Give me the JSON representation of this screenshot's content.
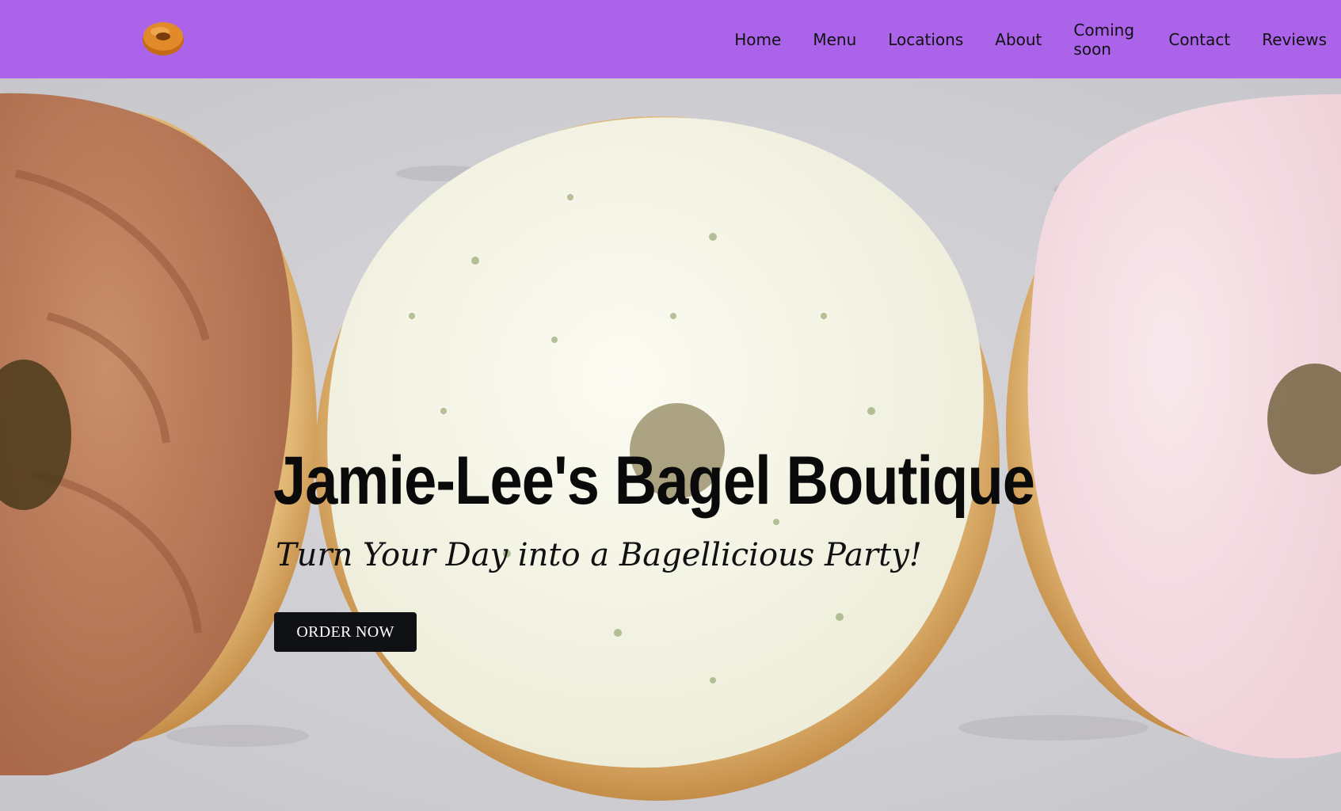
{
  "header": {
    "logo": "bagel-logo-icon",
    "nav": [
      {
        "label": "Home"
      },
      {
        "label": "Menu"
      },
      {
        "label": "Locations"
      },
      {
        "label": "About"
      },
      {
        "label": "Coming soon"
      },
      {
        "label": "Contact"
      },
      {
        "label": "Reviews"
      }
    ]
  },
  "hero": {
    "title": "Jamie-Lee's Bagel Boutique",
    "subtitle": "Turn Your Day into a Bagellicious Party!",
    "cta_label": "ORDER NOW",
    "image": "three-bagels-with-spreads-photo"
  },
  "colors": {
    "header_bg": "#ab63e9",
    "button_bg": "#0f1114",
    "button_text": "#ffffff"
  }
}
